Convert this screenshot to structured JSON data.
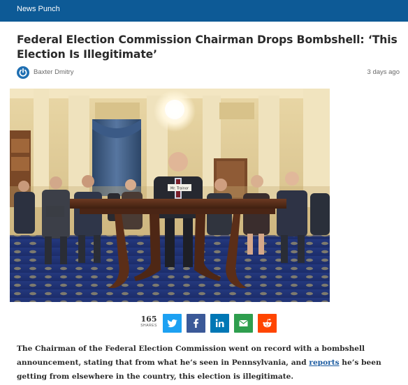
{
  "header": {
    "site_name": "News Punch"
  },
  "article": {
    "title": "Federal Election Commission Chairman Drops Bombshell: ‘This Election Is Illegitimate’",
    "author": "Baxter Dmitry",
    "time_ago": "3 days ago",
    "hero_alt": "Congressional hearing room with witness seated at wooden table",
    "nameplate": "Mr. Trainor",
    "body_before_link": "The Chairman of the Federal Election Commission went on record with a bombshell announcement, stating that from what he’s seen in Pennsylvania, and ",
    "body_link": "reports",
    "body_after_link": " he’s been getting from elsewhere in the country, this election is illegitimate."
  },
  "share": {
    "count": "165",
    "count_label": "SHARES",
    "buttons": [
      {
        "network": "twitter",
        "icon": "twitter-icon",
        "color": "#1da1f2"
      },
      {
        "network": "facebook",
        "icon": "facebook-icon",
        "color": "#3b5998"
      },
      {
        "network": "linkedin",
        "icon": "linkedin-icon",
        "color": "#0077b5"
      },
      {
        "network": "email",
        "icon": "email-icon",
        "color": "#2e9e4e"
      },
      {
        "network": "reddit",
        "icon": "reddit-icon",
        "color": "#ff4500"
      }
    ]
  },
  "colors": {
    "header_bg": "#0d5a96",
    "link": "#1a5aa0"
  }
}
